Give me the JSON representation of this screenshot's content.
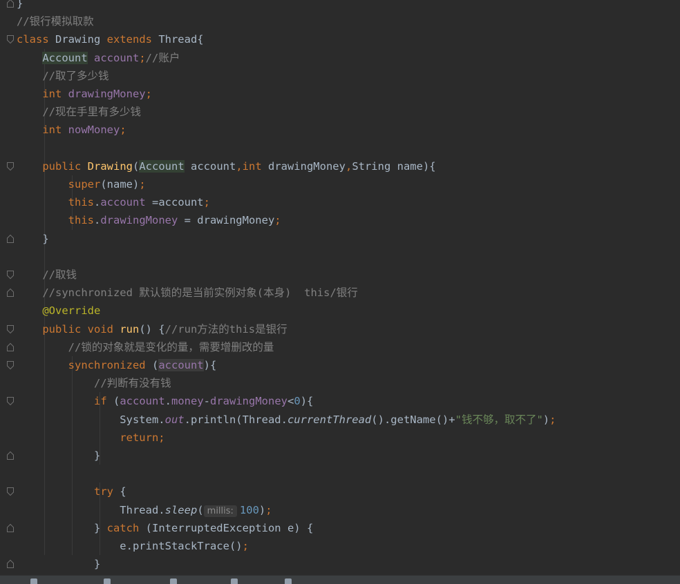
{
  "editor": {
    "lines": [
      [
        {
          "t": "}",
          "c": "pl"
        }
      ],
      [
        {
          "t": "//银行模拟取款",
          "c": "cm"
        }
      ],
      [
        {
          "t": "class ",
          "c": "kw"
        },
        {
          "t": "Drawing ",
          "c": "pl"
        },
        {
          "t": "extends ",
          "c": "kw"
        },
        {
          "t": "Thread{",
          "c": "pl"
        }
      ],
      [
        {
          "t": "    ",
          "c": "pl"
        },
        {
          "t": "Account",
          "c": "pl hl"
        },
        {
          "t": " ",
          "c": "pl"
        },
        {
          "t": "account",
          "c": "fld"
        },
        {
          "t": ";",
          "c": "kw"
        },
        {
          "t": "//账户",
          "c": "cm"
        }
      ],
      [
        {
          "t": "    //取了多少钱",
          "c": "cm"
        }
      ],
      [
        {
          "t": "    ",
          "c": "pl"
        },
        {
          "t": "int ",
          "c": "kw"
        },
        {
          "t": "drawingMoney",
          "c": "fld"
        },
        {
          "t": ";",
          "c": "kw"
        }
      ],
      [
        {
          "t": "    //现在手里有多少钱",
          "c": "cm"
        }
      ],
      [
        {
          "t": "    ",
          "c": "pl"
        },
        {
          "t": "int ",
          "c": "kw"
        },
        {
          "t": "nowMoney",
          "c": "fld"
        },
        {
          "t": ";",
          "c": "kw"
        }
      ],
      [],
      [
        {
          "t": "    ",
          "c": "pl"
        },
        {
          "t": "public ",
          "c": "kw"
        },
        {
          "t": "Drawing",
          "c": "md"
        },
        {
          "t": "(",
          "c": "pl"
        },
        {
          "t": "Account",
          "c": "pl hl"
        },
        {
          "t": " account",
          "c": "pl"
        },
        {
          "t": ",",
          "c": "kw"
        },
        {
          "t": "int ",
          "c": "kw"
        },
        {
          "t": "drawingMoney",
          "c": "pl"
        },
        {
          "t": ",",
          "c": "kw"
        },
        {
          "t": "String name){",
          "c": "pl"
        }
      ],
      [
        {
          "t": "        ",
          "c": "pl"
        },
        {
          "t": "super",
          "c": "kw"
        },
        {
          "t": "(name)",
          "c": "pl"
        },
        {
          "t": ";",
          "c": "kw"
        }
      ],
      [
        {
          "t": "        ",
          "c": "pl"
        },
        {
          "t": "this",
          "c": "kw"
        },
        {
          "t": ".",
          "c": "pl"
        },
        {
          "t": "account",
          "c": "fld"
        },
        {
          "t": " =account",
          "c": "pl"
        },
        {
          "t": ";",
          "c": "kw"
        }
      ],
      [
        {
          "t": "        ",
          "c": "pl"
        },
        {
          "t": "this",
          "c": "kw"
        },
        {
          "t": ".",
          "c": "pl"
        },
        {
          "t": "drawingMoney",
          "c": "fld"
        },
        {
          "t": " = drawingMoney",
          "c": "pl"
        },
        {
          "t": ";",
          "c": "kw"
        }
      ],
      [
        {
          "t": "    }",
          "c": "pl"
        }
      ],
      [],
      [
        {
          "t": "    //取钱",
          "c": "cm"
        }
      ],
      [
        {
          "t": "    //synchronized 默认锁的是当前实例对象(本身)  this/银行",
          "c": "cm"
        }
      ],
      [
        {
          "t": "    ",
          "c": "pl"
        },
        {
          "t": "@Override",
          "c": "ann"
        }
      ],
      [
        {
          "t": "    ",
          "c": "pl"
        },
        {
          "t": "public void ",
          "c": "kw"
        },
        {
          "t": "run",
          "c": "md"
        },
        {
          "t": "() {",
          "c": "pl"
        },
        {
          "t": "//run方法的this是银行",
          "c": "cm"
        }
      ],
      [
        {
          "t": "        //锁的对象就是变化的量，需要增删改的量",
          "c": "cm"
        }
      ],
      [
        {
          "t": "        ",
          "c": "pl"
        },
        {
          "t": "synchronized ",
          "c": "kw"
        },
        {
          "t": "(",
          "c": "pl"
        },
        {
          "t": "account",
          "c": "fld hl2"
        },
        {
          "t": "){",
          "c": "pl"
        }
      ],
      [
        {
          "t": "            //判断有没有钱",
          "c": "cm"
        }
      ],
      [
        {
          "t": "            ",
          "c": "pl"
        },
        {
          "t": "if ",
          "c": "kw"
        },
        {
          "t": "(",
          "c": "pl"
        },
        {
          "t": "account",
          "c": "fld"
        },
        {
          "t": ".",
          "c": "pl"
        },
        {
          "t": "money",
          "c": "fld"
        },
        {
          "t": "-",
          "c": "pl"
        },
        {
          "t": "drawingMoney",
          "c": "fld"
        },
        {
          "t": "<",
          "c": "pl"
        },
        {
          "t": "0",
          "c": "num"
        },
        {
          "t": "){",
          "c": "pl"
        }
      ],
      [
        {
          "t": "                System.",
          "c": "pl"
        },
        {
          "t": "out",
          "c": "fldit"
        },
        {
          "t": ".println(Thread.",
          "c": "pl"
        },
        {
          "t": "currentThread",
          "c": "mit"
        },
        {
          "t": "().getName()+",
          "c": "pl"
        },
        {
          "t": "\"钱不够，取不了\"",
          "c": "str"
        },
        {
          "t": ")",
          "c": "pl"
        },
        {
          "t": ";",
          "c": "kw"
        }
      ],
      [
        {
          "t": "                ",
          "c": "pl"
        },
        {
          "t": "return;",
          "c": "kw"
        }
      ],
      [
        {
          "t": "            }",
          "c": "pl"
        }
      ],
      [],
      [
        {
          "t": "            ",
          "c": "pl"
        },
        {
          "t": "try ",
          "c": "kw"
        },
        {
          "t": "{",
          "c": "pl"
        }
      ],
      [
        {
          "t": "                Thread.",
          "c": "pl"
        },
        {
          "t": "sleep",
          "c": "mit"
        },
        {
          "t": "(",
          "c": "pl"
        },
        {
          "t": "millis:",
          "c": "hint"
        },
        {
          "t": "100",
          "c": "num"
        },
        {
          "t": ")",
          "c": "pl"
        },
        {
          "t": ";",
          "c": "kw"
        }
      ],
      [
        {
          "t": "            } ",
          "c": "pl"
        },
        {
          "t": "catch ",
          "c": "kw"
        },
        {
          "t": "(InterruptedException e) {",
          "c": "pl"
        }
      ],
      [
        {
          "t": "                e.printStackTrace()",
          "c": "pl"
        },
        {
          "t": ";",
          "c": "kw"
        }
      ],
      [
        {
          "t": "            }",
          "c": "pl"
        }
      ]
    ]
  },
  "colors": {
    "background": "#2b2b2b",
    "keyword": "#cc7832",
    "plain": "#a9b7c6",
    "field": "#9876aa",
    "comment": "#808080",
    "string": "#6a8759",
    "number": "#6897bb",
    "annotation": "#bbb529",
    "method_decl": "#ffc66d"
  },
  "icons": {
    "fold_open": "fold-open-icon",
    "fold_close": "fold-close-icon"
  }
}
